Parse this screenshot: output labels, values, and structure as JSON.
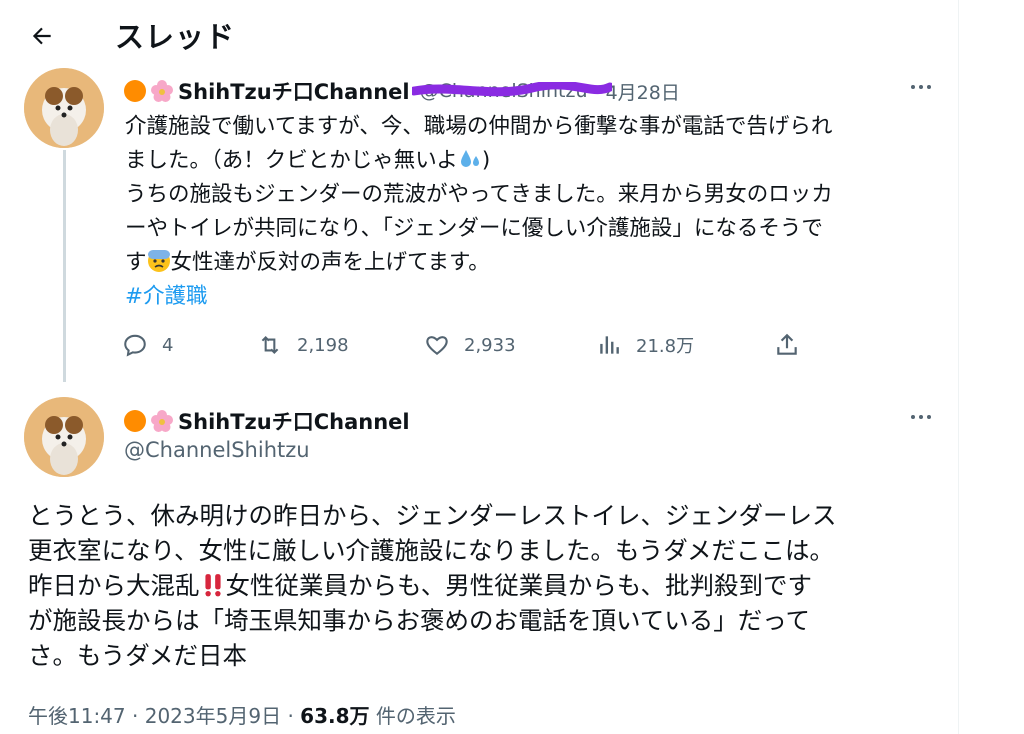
{
  "header": {
    "title": "スレッド"
  },
  "parent_tweet": {
    "display_name": "ShihTzuチ口Channel",
    "handle": "@ChannelShihtzu",
    "date": "4月28日",
    "text_lines": [
      "介護施設で働いてますが、今、職場の仲間から衝撃な事が電話で告げられ",
      "ました。（あ！クビとかじゃ無いよ"
    ],
    "text_line2_end": ")",
    "text_lines_b": [
      "うちの施設もジェンダーの荒波がやってきました。来月から男女のロッカ",
      "ーやトイレが共同になり、「ジェンダーに優しい介護施設」になるそうで",
      "す"
    ],
    "text_line5_end": "女性達が反対の声を上げてます。",
    "hashtag": "#介護職",
    "replies": "4",
    "retweets": "2,198",
    "likes": "2,933",
    "views": "21.8万"
  },
  "main_tweet": {
    "display_name": "ShihTzuチ口Channel",
    "handle": "@ChannelShihtzu",
    "text_a": "とうとう、休み明けの昨日から、ジェンダーレストイレ、ジェンダーレス\n更衣室になり、女性に厳しい介護施設になりました。もうダメだここは。\n昨日から大混乱",
    "text_b": "女性従業員からも、男性従業員からも、批判殺到です\nが施設長からは「埼玉県知事からお褒めのお電話を頂いている」だって\nさ。もうダメだ日本",
    "time": "午後11:47",
    "sep": "·",
    "date": "2023年5月9日",
    "views_count": "63.8万",
    "views_label": "件の表示"
  },
  "icons": {
    "back": "arrow-left-icon",
    "reply": "comment-icon",
    "retweet": "retweet-icon",
    "like": "heart-icon",
    "views": "bar-chart-icon",
    "share": "share-icon",
    "more": "more-dots-icon"
  },
  "colors": {
    "link": "#1d9bf0",
    "secondary": "#536471",
    "text": "#0f1419",
    "dot": "#ff8c00",
    "scribble": "#8a2be2"
  }
}
